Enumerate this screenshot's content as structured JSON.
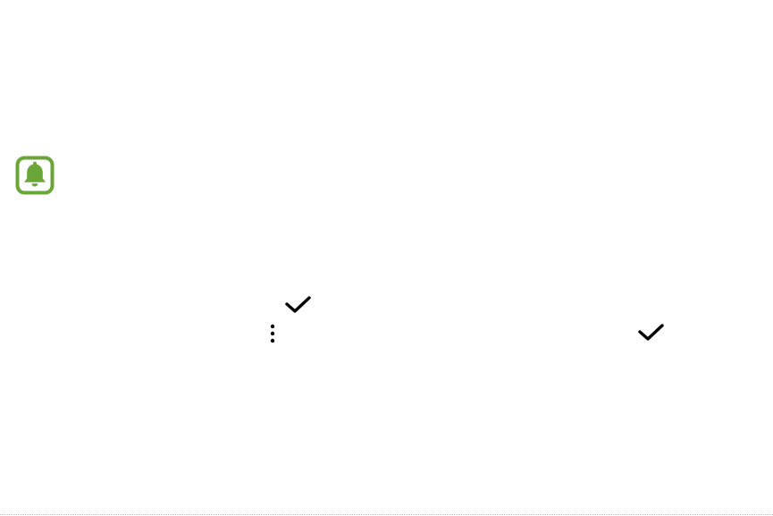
{
  "page": {
    "background": "#ffffff",
    "accent_color": "#6aa637",
    "icon_color": "#000000"
  },
  "notice": {
    "icon": "bell-notification-icon"
  },
  "inline_icons": [
    {
      "icon": "checkmark-icon"
    },
    {
      "icon": "more-options-icon"
    },
    {
      "icon": "checkmark-icon"
    }
  ]
}
